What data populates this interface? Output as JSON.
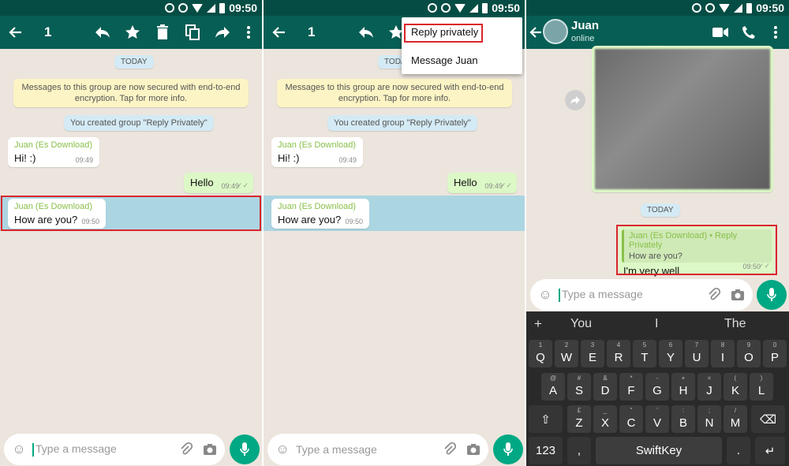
{
  "status": {
    "time": "09:50"
  },
  "panel1": {
    "selected_count": "1",
    "chat": {
      "date_chip": "TODAY",
      "encryption_note": "Messages to this group are now secured with end-to-end encryption. Tap for more info.",
      "group_created": "You created group \"Reply Privately\"",
      "messages": [
        {
          "sender": "Juan (Es Download)",
          "text": "Hi! :)",
          "time": "09:49"
        },
        {
          "text": "Hello",
          "time": "09:49"
        },
        {
          "sender": "Juan (Es Download)",
          "text": "How are you?",
          "time": "09:50"
        }
      ]
    },
    "input_placeholder": "Type a message"
  },
  "panel2": {
    "selected_count": "1",
    "menu": [
      "Reply privately",
      "Message Juan"
    ],
    "chat": {
      "date_chip": "TODA",
      "encryption_note": "Messages to this group are now secured with end-to-end encryption. Tap for more info.",
      "group_created": "You created group \"Reply Privately\"",
      "messages": [
        {
          "sender": "Juan (Es Download)",
          "text": "Hi! :)",
          "time": "09:49"
        },
        {
          "text": "Hello",
          "time": "09:49"
        },
        {
          "sender": "Juan (Es Download)",
          "text": "How are you?",
          "time": "09:50"
        }
      ]
    },
    "input_placeholder": "Type a message"
  },
  "panel3": {
    "contact_name": "Juan",
    "contact_status": "online",
    "date_chip": "TODAY",
    "reply": {
      "quoted_sender": "Juan (Es Download) • Reply Privately",
      "quoted_text": "How are you?",
      "text": "I'm very well",
      "time": "09:50"
    },
    "input_placeholder": "Type a message",
    "keyboard": {
      "suggestions": [
        "+",
        "You",
        "I",
        "The"
      ],
      "row1": [
        [
          "Q",
          "1"
        ],
        [
          "W",
          "2"
        ],
        [
          "E",
          "3"
        ],
        [
          "R",
          "4"
        ],
        [
          "T",
          "5"
        ],
        [
          "Y",
          "6"
        ],
        [
          "U",
          "7"
        ],
        [
          "I",
          "8"
        ],
        [
          "O",
          "9"
        ],
        [
          "P",
          "0"
        ]
      ],
      "row2": [
        [
          "A",
          "@"
        ],
        [
          "S",
          "#"
        ],
        [
          "D",
          "&"
        ],
        [
          "F",
          "*"
        ],
        [
          "G",
          "-"
        ],
        [
          "H",
          "+"
        ],
        [
          "J",
          "="
        ],
        [
          "K",
          "("
        ],
        [
          "L",
          ")"
        ]
      ],
      "row3": [
        [
          "Z",
          "£"
        ],
        [
          "X",
          "_"
        ],
        [
          "C",
          "\""
        ],
        [
          "V",
          "'"
        ],
        [
          "B",
          ":"
        ],
        [
          "N",
          ";"
        ],
        [
          "M",
          "/"
        ]
      ],
      "num_key": "123",
      "space_label": "SwiftKey",
      "comma": ",",
      "period": "."
    }
  },
  "colors": {
    "header": "#075e54",
    "statusbar": "#054d44",
    "accent": "#00a884",
    "highlight": "#d9262b"
  }
}
